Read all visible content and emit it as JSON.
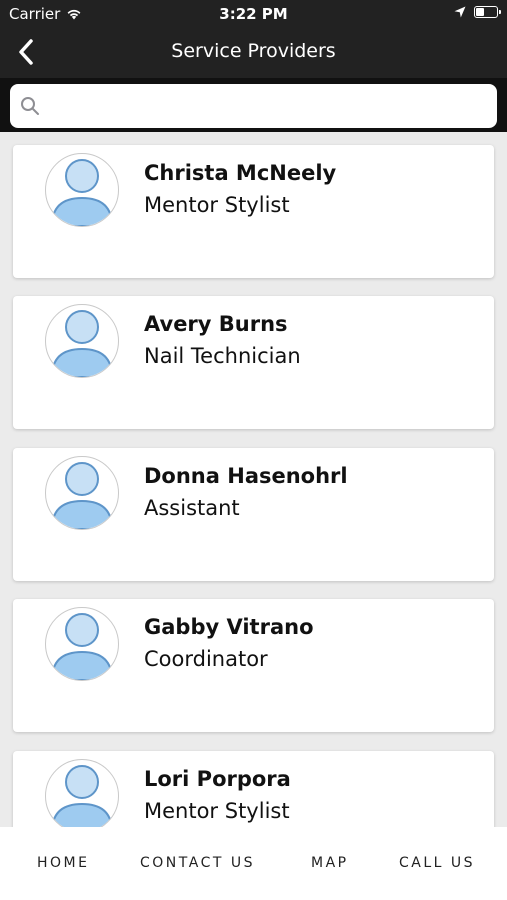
{
  "status_bar": {
    "carrier": "Carrier",
    "time": "3:22 PM",
    "icons": [
      "wifi-icon",
      "location-arrow-icon",
      "battery-icon"
    ]
  },
  "nav": {
    "title": "Service Providers",
    "back_icon": "chevron-left-icon"
  },
  "search": {
    "placeholder": "",
    "value": "",
    "icon": "search-icon"
  },
  "providers": [
    {
      "name": "Christa McNeely",
      "role": "Mentor Stylist"
    },
    {
      "name": "Avery Burns",
      "role": "Nail Technician"
    },
    {
      "name": "Donna Hasenohrl",
      "role": "Assistant"
    },
    {
      "name": "Gabby Vitrano",
      "role": "Coordinator"
    },
    {
      "name": "Lori Porpora",
      "role": "Mentor Stylist"
    }
  ],
  "tabs": [
    {
      "label": "HOME"
    },
    {
      "label": "CONTACT US"
    },
    {
      "label": "MAP"
    },
    {
      "label": "CALL US"
    }
  ],
  "colors": {
    "header_bg": "#222222",
    "background": "#ebebeb",
    "avatar_fill": "#c7e0f5",
    "avatar_stroke": "#5e95c9"
  }
}
